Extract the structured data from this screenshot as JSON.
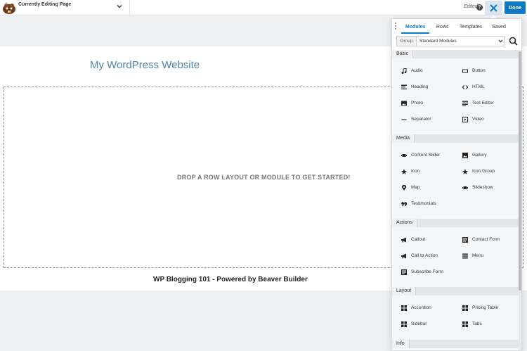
{
  "topbar": {
    "editing_label": "Currently Editing Page",
    "edited_label": "Edited",
    "help_symbol": "?",
    "done_label": "Done"
  },
  "page": {
    "site_title": "My WordPress Website",
    "drop_text": "DROP A ROW LAYOUT OR MODULE TO GET STARTED!",
    "footer_text": "WP Blogging 101 - Powered by Beaver Builder"
  },
  "panel": {
    "tabs": [
      {
        "label": "Modules"
      },
      {
        "label": "Rows"
      },
      {
        "label": "Templates"
      },
      {
        "label": "Saved"
      }
    ],
    "group_label": "Group",
    "group_value": "Standard Modules",
    "sections": {
      "basic": {
        "title": "Basic",
        "items": [
          {
            "label": "Audio",
            "icon": "music-note-icon"
          },
          {
            "label": "Button",
            "icon": "button-icon"
          },
          {
            "label": "Heading",
            "icon": "heading-icon"
          },
          {
            "label": "HTML",
            "icon": "code-icon"
          },
          {
            "label": "Photo",
            "icon": "photo-icon"
          },
          {
            "label": "Text Editor",
            "icon": "text-editor-icon"
          },
          {
            "label": "Separator",
            "icon": "separator-icon"
          },
          {
            "label": "Video",
            "icon": "video-icon"
          }
        ]
      },
      "media": {
        "title": "Media",
        "items": [
          {
            "label": "Content Slider",
            "icon": "slider-icon"
          },
          {
            "label": "Gallery",
            "icon": "gallery-icon"
          },
          {
            "label": "Icon",
            "icon": "star-icon"
          },
          {
            "label": "Icon Group",
            "icon": "star-icon"
          },
          {
            "label": "Map",
            "icon": "map-pin-icon"
          },
          {
            "label": "Slideshow",
            "icon": "slideshow-icon"
          },
          {
            "label": "Testimonials",
            "icon": "quote-icon"
          }
        ]
      },
      "actions": {
        "title": "Actions",
        "items": [
          {
            "label": "Callout",
            "icon": "megaphone-icon"
          },
          {
            "label": "Contact Form",
            "icon": "form-icon"
          },
          {
            "label": "Call to Action",
            "icon": "megaphone-icon"
          },
          {
            "label": "Menu",
            "icon": "menu-icon"
          },
          {
            "label": "Subscribe Form",
            "icon": "form-icon"
          }
        ]
      },
      "layout": {
        "title": "Layout",
        "items": [
          {
            "label": "Accordion",
            "icon": "grid-icon"
          },
          {
            "label": "Pricing Table",
            "icon": "grid-icon"
          },
          {
            "label": "Sidebar",
            "icon": "grid-icon"
          },
          {
            "label": "Tabs",
            "icon": "grid-icon"
          }
        ]
      },
      "info": {
        "title": "Info"
      }
    }
  },
  "colors": {
    "accent": "#0e7ac4",
    "title_blue": "#4a82b0",
    "panel_bg": "#f4f6f8"
  }
}
